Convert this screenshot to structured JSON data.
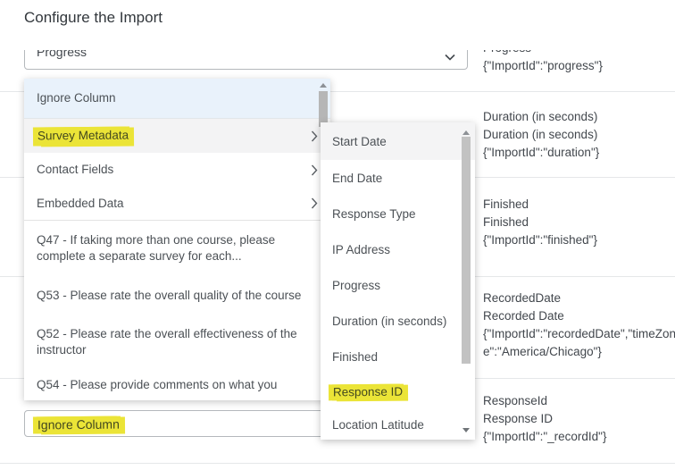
{
  "title": "Configure the Import",
  "colors": {
    "highlight_marker": "#ebe437",
    "selected_item_bg": "#e9f2fb",
    "hover_item_bg": "#f3f3f4"
  },
  "top_select": {
    "value": "Progress"
  },
  "bottom_select": {
    "value": "Ignore Column"
  },
  "dropdown_menu": {
    "items": [
      {
        "label": "Ignore Column"
      },
      {
        "label": "Survey Metadata"
      },
      {
        "label": "Contact Fields"
      },
      {
        "label": "Embedded Data"
      },
      {
        "label": "Q47 - If taking more than one course, please complete a separate survey for each..."
      },
      {
        "label": "Q53 - Please rate the overall quality of the course"
      },
      {
        "label": "Q52 - Please rate the overall effectiveness of the instructor"
      },
      {
        "label": "Q54 - Please provide comments on what you"
      }
    ]
  },
  "submenu": {
    "items": [
      {
        "label": "Start Date"
      },
      {
        "label": "End Date"
      },
      {
        "label": "Response Type"
      },
      {
        "label": "IP Address"
      },
      {
        "label": "Progress"
      },
      {
        "label": "Duration (in seconds)"
      },
      {
        "label": "Finished"
      },
      {
        "label": "Response ID"
      },
      {
        "label": "Location Latitude"
      }
    ]
  },
  "field_rows": [
    {
      "lines": [
        "Progress",
        "{\"ImportId\":\"progress\"}"
      ]
    },
    {
      "lines": [
        "Duration (in seconds)",
        "Duration (in seconds)",
        "{\"ImportId\":\"duration\"}"
      ]
    },
    {
      "lines": [
        "Finished",
        "Finished",
        "{\"ImportId\":\"finished\"}"
      ]
    },
    {
      "lines": [
        "RecordedDate",
        "Recorded Date",
        "{\"ImportId\":\"recordedDate\",\"timeZone\":\"America/Chicago\"}"
      ]
    },
    {
      "lines": [
        "ResponseId",
        "Response ID",
        "{\"ImportId\":\"_recordId\"}"
      ]
    }
  ]
}
